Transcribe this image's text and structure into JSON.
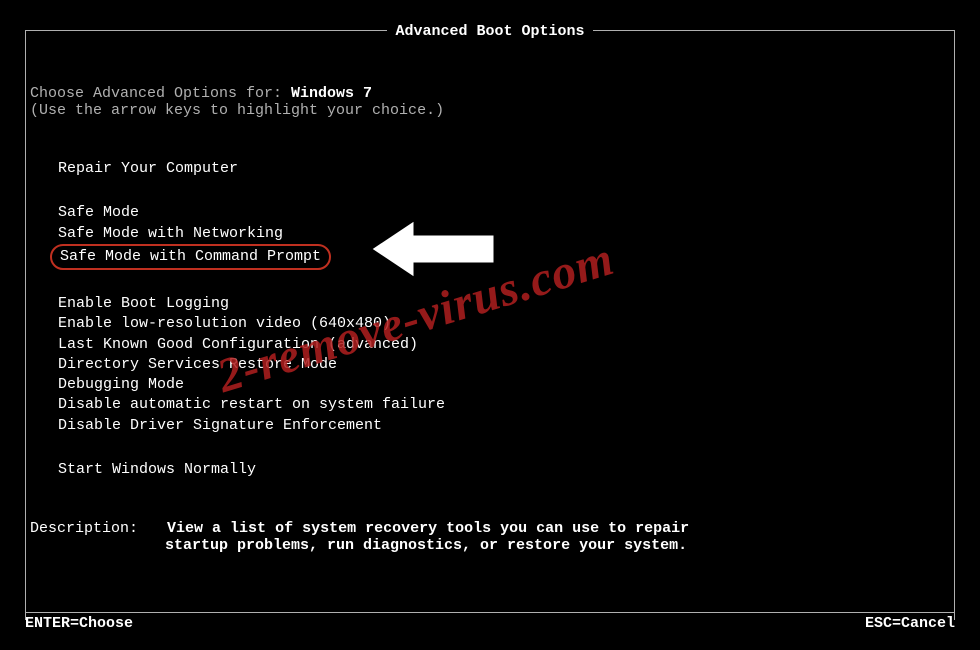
{
  "title": "Advanced Boot Options",
  "choose_prefix": "Choose Advanced Options for: ",
  "os_name": "Windows 7",
  "hint": "(Use the arrow keys to highlight your choice.)",
  "menu": {
    "repair": "Repair Your Computer",
    "safe_mode": "Safe Mode",
    "safe_mode_net": "Safe Mode with Networking",
    "safe_mode_cmd": "Safe Mode with Command Prompt",
    "boot_logging": "Enable Boot Logging",
    "low_res": "Enable low-resolution video (640x480)",
    "last_known": "Last Known Good Configuration (advanced)",
    "ds_restore": "Directory Services Restore Mode",
    "debugging": "Debugging Mode",
    "disable_restart": "Disable automatic restart on system failure",
    "disable_driver_sig": "Disable Driver Signature Enforcement",
    "start_normal": "Start Windows Normally"
  },
  "description": {
    "label": "Description:",
    "line1": "View a list of system recovery tools you can use to repair",
    "line2": "startup problems, run diagnostics, or restore your system."
  },
  "footer": {
    "enter": "ENTER=Choose",
    "esc": "ESC=Cancel"
  },
  "watermark": "2-remove-virus.com"
}
